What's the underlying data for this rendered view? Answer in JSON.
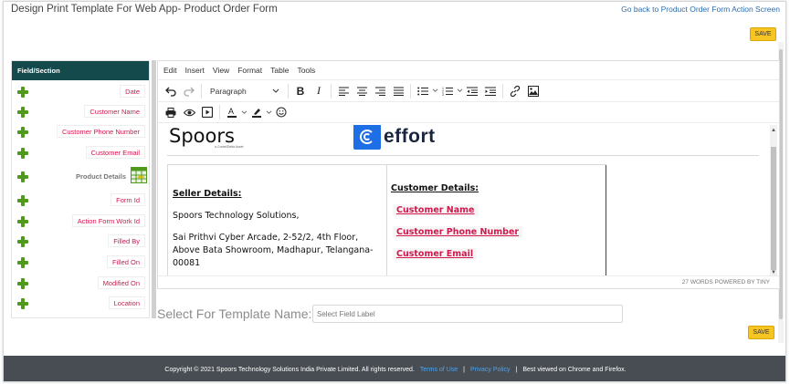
{
  "header": {
    "title": "Design Print Template For Web App- Product Order Form",
    "back_link": "Go back to Product Order Form Action Screen",
    "save_label": "SAVE"
  },
  "field_panel": {
    "title": "Field/Section",
    "fields": [
      {
        "label": "Date"
      },
      {
        "label": "Customer Name"
      },
      {
        "label": "Customer Phone Number"
      },
      {
        "label": "Customer Email"
      },
      {
        "label": "Product Details"
      },
      {
        "label": "Form Id"
      },
      {
        "label": "Action Form Work Id"
      },
      {
        "label": "Filled By"
      },
      {
        "label": "Filled On"
      },
      {
        "label": "Modified On"
      },
      {
        "label": "Location"
      }
    ]
  },
  "editor": {
    "menu": [
      "Edit",
      "Insert",
      "View",
      "Format",
      "Table",
      "Tools"
    ],
    "block_format": "Paragraph",
    "status": "27 WORDS  POWERED BY TINY",
    "logo_left": "Spoors",
    "logo_left_sub": "a ContellDelta Asset",
    "logo_right": "effort",
    "seller": {
      "heading": "Seller Details:",
      "company": "Spoors Technology Solutions,",
      "address": "Sai Prithvi Cyber Arcade, 2-52/2, 4th Floor, Above Bata Showroom, Madhapur, Telangana-00081"
    },
    "customer": {
      "heading": "Customer Details:",
      "fields": [
        "Customer Name",
        "Customer Phone Number",
        "Customer Email"
      ]
    }
  },
  "template_select": {
    "label": "Select For Template Name:",
    "placeholder": "Select Field Label"
  },
  "footer": {
    "copyright": "Copyright © 2021 Spoors Technology Solutions India Private Limited. All rights reserved.",
    "terms": "Terms of Use",
    "sep1": "|",
    "privacy": "Privacy Policy",
    "sep2": "|",
    "browser_note": "Best viewed on Chrome and Firefox."
  },
  "colors": {
    "accent_yellow": "#f6c524",
    "panel_header": "#154a4d",
    "field_red": "#d2184d",
    "plus_green": "#4f9a1d",
    "footer_bg": "#474d52",
    "effort_blue": "#1e6ee6"
  }
}
